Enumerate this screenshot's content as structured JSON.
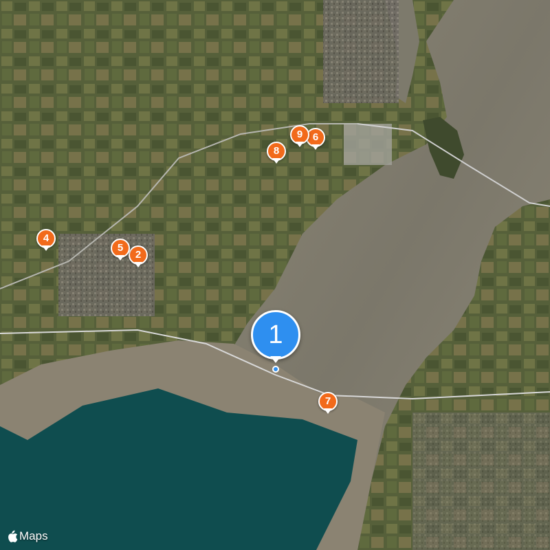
{
  "map": {
    "attribution": {
      "brand_icon": "apple-logo-icon",
      "label": "Maps"
    },
    "colors": {
      "land": "#4f5a37",
      "farmland": "#6c7144",
      "tidal_flats": "#8c8471",
      "estuary_water": "#7d786a",
      "sea": "#0f4d4f",
      "pin_orange": "#f26a1b",
      "pin_blue": "#2e8ff0"
    },
    "markers": [
      {
        "id": "marker-1",
        "label": "1",
        "style": "primary"
      },
      {
        "id": "marker-2",
        "label": "2",
        "style": "secondary"
      },
      {
        "id": "marker-4",
        "label": "4",
        "style": "secondary"
      },
      {
        "id": "marker-5",
        "label": "5",
        "style": "secondary"
      },
      {
        "id": "marker-6",
        "label": "6",
        "style": "secondary"
      },
      {
        "id": "marker-7",
        "label": "7",
        "style": "secondary"
      },
      {
        "id": "marker-8",
        "label": "8",
        "style": "secondary"
      },
      {
        "id": "marker-9",
        "label": "9",
        "style": "secondary"
      }
    ]
  }
}
